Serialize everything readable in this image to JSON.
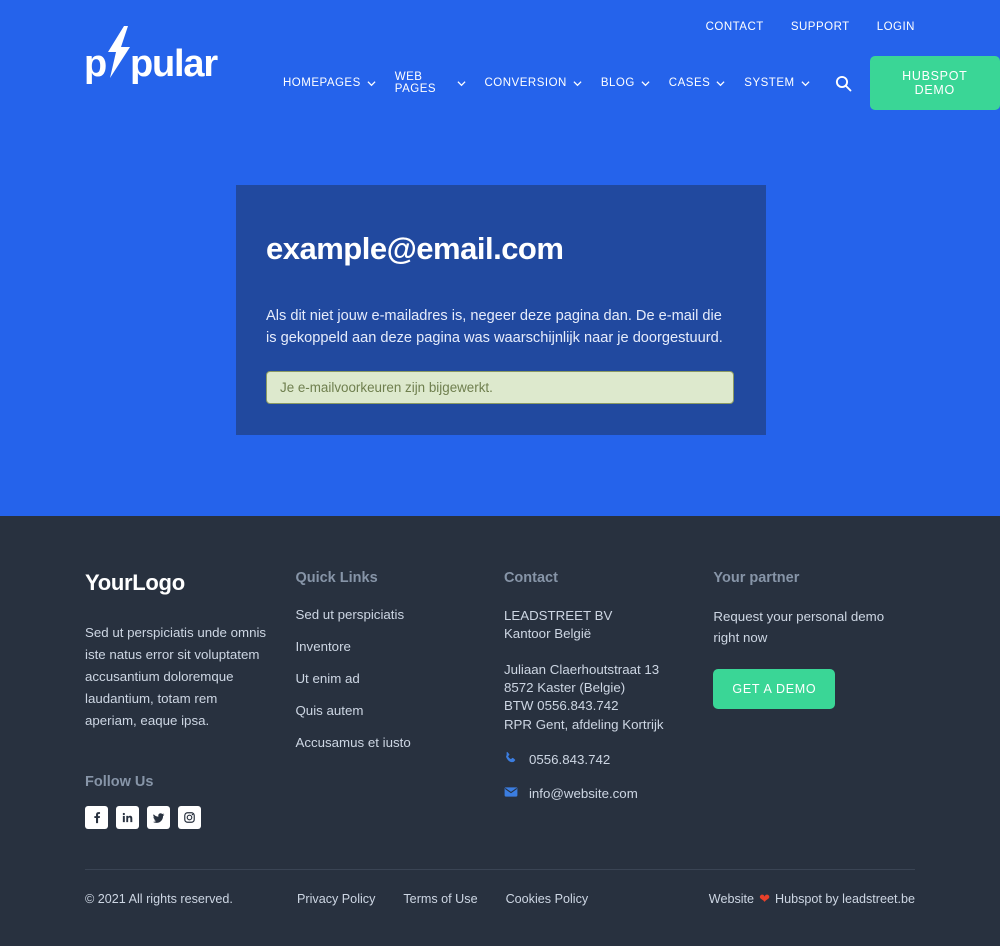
{
  "theme": {
    "blue": "#2563eb",
    "card_blue": "#21499f",
    "green": "#3ad696",
    "footer_dark": "#28313f",
    "alert_bg": "#dde9cd",
    "alert_border": "#8a9a63",
    "alert_text": "#6f7f4e",
    "icon_blue": "#3b7de0"
  },
  "header": {
    "logo_text_before": "p",
    "logo_icon": "lightning-bolt-icon",
    "logo_text_after": "pular",
    "toplinks": [
      {
        "label": "CONTACT"
      },
      {
        "label": "SUPPORT"
      },
      {
        "label": "LOGIN"
      }
    ],
    "nav": [
      {
        "label": "HOMEPAGES",
        "has_caret": true
      },
      {
        "label": "WEB PAGES",
        "has_caret": true
      },
      {
        "label": "CONVERSION",
        "has_caret": true
      },
      {
        "label": "BLOG",
        "has_caret": true
      },
      {
        "label": "CASES",
        "has_caret": true
      },
      {
        "label": "SYSTEM",
        "has_caret": true
      }
    ],
    "search_icon": "search-icon",
    "cta_label": "HUBSPOT DEMO"
  },
  "card": {
    "title": "example@email.com",
    "body": "Als dit niet jouw e-mailadres is, negeer deze pagina dan. De e-mail die is gekoppeld aan deze pagina was waarschijnlijk naar je doorgestuurd.",
    "alert": "Je e-mailvoorkeuren zijn bijgewerkt."
  },
  "footer": {
    "brand": {
      "logo": "YourLogo",
      "description": "Sed ut perspiciatis unde omnis iste natus error sit voluptatem accusantium doloremque laudantium, totam rem aperiam, eaque ipsa.",
      "follow_heading": "Follow Us",
      "socials": [
        {
          "name": "facebook-icon"
        },
        {
          "name": "linkedin-icon"
        },
        {
          "name": "twitter-icon"
        },
        {
          "name": "instagram-icon"
        }
      ]
    },
    "quick_links": {
      "heading": "Quick Links",
      "items": [
        {
          "label": "Sed ut perspiciatis"
        },
        {
          "label": "Inventore"
        },
        {
          "label": "Ut enim ad"
        },
        {
          "label": "Quis autem"
        },
        {
          "label": "Accusamus et iusto"
        }
      ]
    },
    "contact": {
      "heading": "Contact",
      "company_line1": "LEADSTREET BV",
      "company_line2": "Kantoor België",
      "address_line1": "Juliaan Claerhoutstraat 13",
      "address_line2": "8572 Kaster (Belgie)",
      "address_line3": "BTW 0556.843.742",
      "address_line4": "RPR Gent, afdeling Kortrijk",
      "phone": "0556.843.742",
      "phone_icon": "phone-icon",
      "email": "info@website.com",
      "email_icon": "envelope-icon"
    },
    "partner": {
      "heading": "Your partner",
      "text": "Request your personal demo right now",
      "cta_label": "GET A DEMO"
    },
    "bottom": {
      "copyright": "© 2021 All rights reserved.",
      "legal": [
        {
          "label": "Privacy Policy"
        },
        {
          "label": "Terms of Use"
        },
        {
          "label": "Cookies Policy"
        }
      ],
      "credit_prefix": "Website",
      "credit_heart": "❤",
      "credit_suffix": "Hubspot by leadstreet.be"
    }
  }
}
